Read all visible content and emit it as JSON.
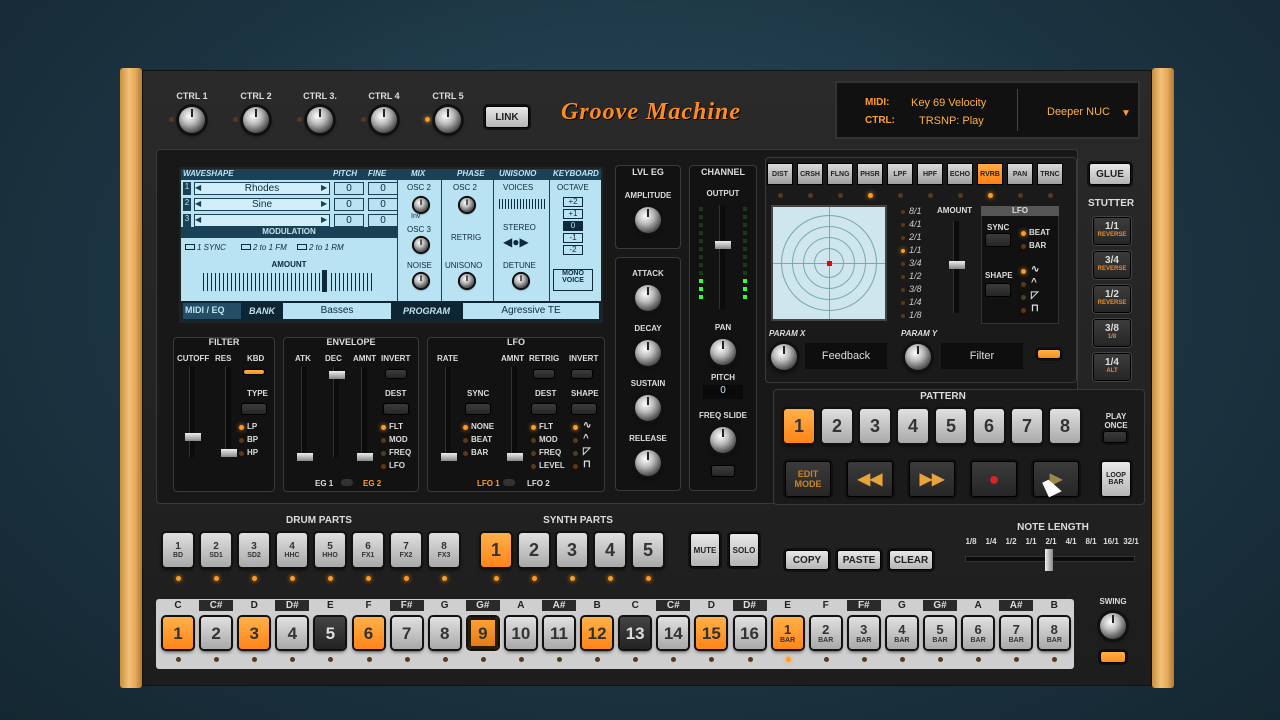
{
  "header": {
    "ctrls": [
      "CTRL 1",
      "CTRL 2",
      "CTRL 3.",
      "CTRL 4",
      "CTRL 5"
    ],
    "link": "LINK",
    "midi_label": "MIDI:",
    "midi_value": "Key 69 Velocity",
    "ctrl_label": "CTRL:",
    "ctrl_value": "TRSNP: Play",
    "preset": "Deeper NUC",
    "logo": "Groove Machine"
  },
  "synth": {
    "headers": [
      "WAVESHAPE",
      "PITCH",
      "FINE",
      "MIX",
      "PHASE",
      "UNISONO",
      "KEYBOARD"
    ],
    "rows": [
      {
        "n": "1",
        "wave": "Rhodes",
        "pitch": "0",
        "fine": "0"
      },
      {
        "n": "2",
        "wave": "Sine",
        "pitch": "0",
        "fine": "0"
      },
      {
        "n": "3",
        "wave": "",
        "pitch": "0",
        "fine": "0"
      }
    ],
    "osc2": "OSC 2",
    "inv": "Inv",
    "osc3": "OSC 3",
    "noise": "NOISE",
    "phase_osc2": "OSC 2",
    "retrig": "RETRIG",
    "unisono": "UNISONO",
    "voices": "VOICES",
    "stereo": "STEREO",
    "detune": "DETUNE",
    "octave": "OCTAVE",
    "octaves": [
      "+2",
      "+1",
      "0",
      "-1",
      "-2"
    ],
    "mono_voice": "MONO VOICE",
    "modulation": "MODULATION",
    "mod_opts": [
      "1 SYNC",
      "2 to 1 FM",
      "2 to 1 RM"
    ],
    "amount": "AMOUNT",
    "midi_eq": "MIDI / EQ",
    "bank_label": "BANK",
    "bank": "Basses",
    "program_label": "PROGRAM",
    "program": "Agressive TE"
  },
  "filter": {
    "title": "FILTER",
    "cutoff": "CUTOFF",
    "res": "RES",
    "kbd": "KBD",
    "type": "TYPE",
    "types": [
      "LP",
      "BP",
      "HP"
    ]
  },
  "envelope": {
    "title": "ENVELOPE",
    "atk": "ATK",
    "dec": "DEC",
    "amnt": "AMNT",
    "invert": "INVERT",
    "dest": "DEST",
    "dests": [
      "FLT",
      "MOD",
      "FREQ",
      "LFO"
    ],
    "eg1": "EG 1",
    "eg2": "EG 2"
  },
  "lfo": {
    "title": "LFO",
    "rate": "RATE",
    "sync": "SYNC",
    "syncs": [
      "NONE",
      "BEAT",
      "BAR"
    ],
    "amnt": "AMNT",
    "retrig": "RETRIG",
    "invert": "INVERT",
    "dest": "DEST",
    "dests": [
      "FLT",
      "MOD",
      "FREQ",
      "LEVEL"
    ],
    "shape": "SHAPE",
    "lfo1": "LFO 1",
    "lfo2": "LFO 2"
  },
  "lvleg": {
    "title": "LVL EG",
    "amplitude": "AMPLITUDE",
    "attack": "ATTACK",
    "decay": "DECAY",
    "sustain": "SUSTAIN",
    "release": "RELEASE"
  },
  "channel": {
    "title": "CHANNEL",
    "output": "OUTPUT",
    "pan": "PAN",
    "pitch": "PITCH",
    "pitch_val": "0",
    "freq_slide": "FREQ SLIDE"
  },
  "fx": {
    "buttons": [
      "DIST",
      "CRSH",
      "FLNG",
      "PHSR",
      "LPF",
      "HPF",
      "ECHO",
      "RVRB",
      "PAN",
      "TRNC"
    ],
    "active": "RVRB",
    "rates": [
      "8/1",
      "4/1",
      "2/1",
      "1/1",
      "3/4",
      "1/2",
      "3/8",
      "1/4",
      "1/8"
    ],
    "amount": "AMOUNT",
    "lfo": "LFO",
    "sync": "SYNC",
    "beat": "BEAT",
    "bar": "BAR",
    "shape": "SHAPE",
    "param_x": "PARAM X",
    "param_x_val": "Feedback",
    "param_y": "PARAM Y",
    "param_y_val": "Filter"
  },
  "side": {
    "glue": "GLUE",
    "stutter": "STUTTER",
    "stutters": [
      {
        "v": "1/1",
        "s": "REVERSE"
      },
      {
        "v": "3/4",
        "s": "REVERSE"
      },
      {
        "v": "1/2",
        "s": "REVERSE"
      },
      {
        "v": "3/8",
        "s": "1/8"
      },
      {
        "v": "1/4",
        "s": "ALT"
      }
    ]
  },
  "pattern": {
    "title": "PATTERN",
    "nums": [
      "1",
      "2",
      "3",
      "4",
      "5",
      "6",
      "7",
      "8"
    ],
    "play_once": "PLAY ONCE",
    "edit_mode": "EDIT MODE",
    "loop_bar": "LOOP BAR"
  },
  "drum": {
    "title": "DRUM PARTS",
    "parts": [
      {
        "n": "1",
        "s": "BD"
      },
      {
        "n": "2",
        "s": "SD1"
      },
      {
        "n": "3",
        "s": "SD2"
      },
      {
        "n": "4",
        "s": "HHC"
      },
      {
        "n": "5",
        "s": "HHO"
      },
      {
        "n": "6",
        "s": "FX1"
      },
      {
        "n": "7",
        "s": "FX2"
      },
      {
        "n": "8",
        "s": "FX3"
      }
    ]
  },
  "synthparts": {
    "title": "SYNTH PARTS",
    "nums": [
      "1",
      "2",
      "3",
      "4",
      "5"
    ],
    "mute": "MUTE",
    "solo": "SOLO"
  },
  "edit": {
    "copy": "COPY",
    "paste": "PASTE",
    "clear": "CLEAR"
  },
  "notelength": {
    "title": "NOTE LENGTH",
    "vals": [
      "1/8",
      "1/4",
      "1/2",
      "1/1",
      "2/1",
      "4/1",
      "8/1",
      "16/1",
      "32/1"
    ]
  },
  "steps": {
    "notes": [
      "C",
      "C#",
      "D",
      "D#",
      "E",
      "F",
      "F#",
      "G",
      "G#",
      "A",
      "A#",
      "B",
      "C",
      "C#",
      "D",
      "D#",
      "E",
      "F",
      "F#",
      "G",
      "G#",
      "A",
      "A#",
      "B"
    ],
    "nums": [
      "1",
      "2",
      "3",
      "4",
      "5",
      "6",
      "7",
      "8",
      "9",
      "10",
      "11",
      "12",
      "13",
      "14",
      "15",
      "16",
      "1",
      "2",
      "3",
      "4",
      "5",
      "6",
      "7",
      "8"
    ],
    "bar": "BAR",
    "swing": "SWING"
  }
}
